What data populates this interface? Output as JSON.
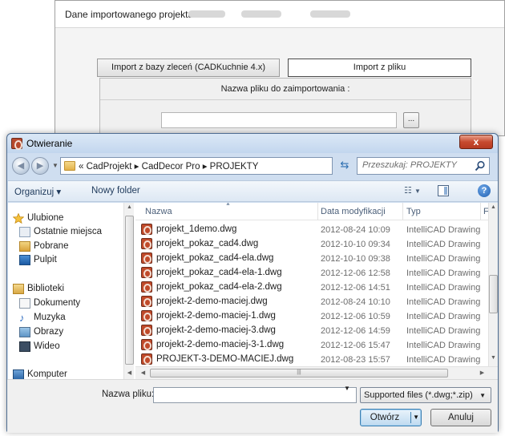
{
  "background_window": {
    "title": "Dane importowanego projektu",
    "tab_db": "Import z bazy zleceń (CADKuchnie 4.x)",
    "tab_file": "Import z pliku",
    "panel_label": "Nazwa pliku do zaimportowania :",
    "browse_label": "..."
  },
  "dialog": {
    "title": "Otwieranie",
    "close_label": "x",
    "address": {
      "path": "«  CadProjekt  ▸  CadDecor Pro  ▸  PROJEKTY"
    },
    "search": {
      "placeholder": "Przeszukaj: PROJEKTY"
    },
    "toolbar": {
      "organize": "Organizuj ▾",
      "new_folder": "Nowy folder",
      "help": "?"
    },
    "nav": {
      "items": [
        {
          "label": "Ulubione",
          "icon": "star-icon"
        },
        {
          "label": "Ostatnie miejsca",
          "icon": "recent-places-icon"
        },
        {
          "label": "Pobrane",
          "icon": "downloads-icon"
        },
        {
          "label": "Pulpit",
          "icon": "desktop-icon"
        },
        {
          "label": "Biblioteki",
          "icon": "libraries-icon"
        },
        {
          "label": "Dokumenty",
          "icon": "documents-icon"
        },
        {
          "label": "Muzyka",
          "icon": "music-icon"
        },
        {
          "label": "Obrazy",
          "icon": "pictures-icon"
        },
        {
          "label": "Wideo",
          "icon": "video-icon"
        },
        {
          "label": "Komputer",
          "icon": "computer-icon"
        }
      ]
    },
    "columns": {
      "name": "Nazwa",
      "date": "Data modyfikacji",
      "type": "Typ",
      "more": "F"
    },
    "files": [
      {
        "name": "projekt_1demo.dwg",
        "date": "2012-08-24 10:09",
        "type": "IntelliCAD Drawing"
      },
      {
        "name": "projekt_pokaz_cad4.dwg",
        "date": "2012-10-10 09:34",
        "type": "IntelliCAD Drawing"
      },
      {
        "name": "projekt_pokaz_cad4-ela.dwg",
        "date": "2012-10-10 09:38",
        "type": "IntelliCAD Drawing"
      },
      {
        "name": "projekt_pokaz_cad4-ela-1.dwg",
        "date": "2012-12-06 12:58",
        "type": "IntelliCAD Drawing"
      },
      {
        "name": "projekt_pokaz_cad4-ela-2.dwg",
        "date": "2012-12-06 14:51",
        "type": "IntelliCAD Drawing"
      },
      {
        "name": "projekt-2-demo-maciej.dwg",
        "date": "2012-08-24 10:10",
        "type": "IntelliCAD Drawing"
      },
      {
        "name": "projekt-2-demo-maciej-1.dwg",
        "date": "2012-12-06 10:59",
        "type": "IntelliCAD Drawing"
      },
      {
        "name": "projekt-2-demo-maciej-3.dwg",
        "date": "2012-12-06 14:59",
        "type": "IntelliCAD Drawing"
      },
      {
        "name": "projekt-2-demo-maciej-3-1.dwg",
        "date": "2012-12-06 15:47",
        "type": "IntelliCAD Drawing"
      },
      {
        "name": "PROJEKT-3-DEMO-MACIEJ.dwg",
        "date": "2012-08-23 15:57",
        "type": "IntelliCAD Drawing"
      }
    ],
    "bottom": {
      "filename_label": "Nazwa pliku:",
      "filename_value": "",
      "filter": "Supported files (*.dwg;*.zip)",
      "open": "Otwórz",
      "cancel": "Anuluj"
    }
  }
}
